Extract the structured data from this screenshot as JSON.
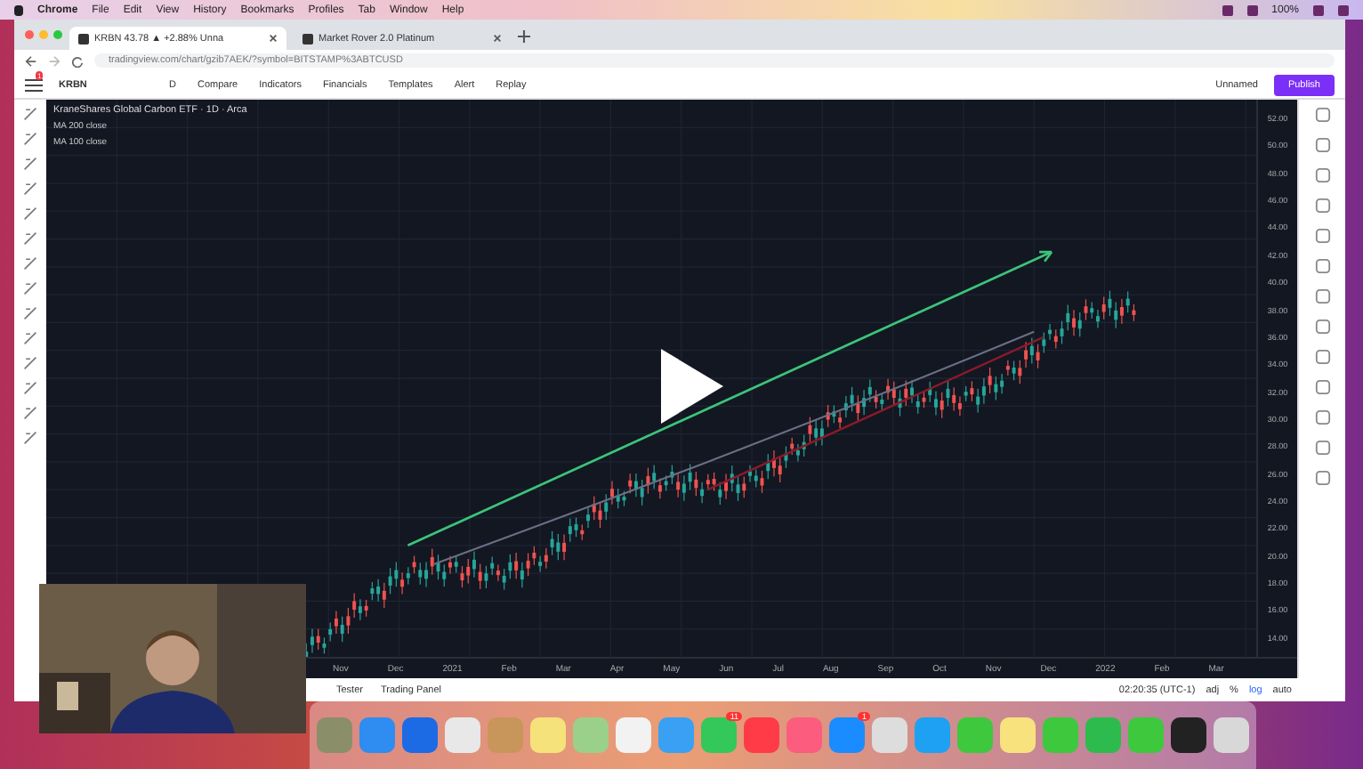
{
  "menu_bar": {
    "items": [
      "Chrome",
      "File",
      "Edit",
      "View",
      "History",
      "Bookmarks",
      "Profiles",
      "Tab",
      "Window",
      "Help"
    ],
    "battery": "100%"
  },
  "browser": {
    "tabs": [
      {
        "title": "KRBN 43.78 ▲ +2.88% Unna",
        "selected": true
      },
      {
        "title": "Market Rover 2.0 Platinum",
        "selected": false
      }
    ],
    "url": "tradingview.com/chart/gzib7AEK/?symbol=BITSTAMP%3ABTCUSD"
  },
  "toolbar": {
    "symbol": "KRBN",
    "interval": "D",
    "buttons": [
      "Compare",
      "Indicators",
      "Financials",
      "Templates",
      "Alert",
      "Replay"
    ],
    "layout_name": "Unnamed",
    "publish": "Publish",
    "alerts_badge": "1"
  },
  "chart": {
    "legend_title": "KraneShares Global Carbon ETF · 1D · Arca",
    "indicators": [
      "MA 200 close",
      "MA 100 close"
    ],
    "price_axis": [
      "52.00",
      "50.00",
      "48.00",
      "46.00",
      "44.00",
      "42.00",
      "40.00",
      "38.00",
      "36.00",
      "34.00",
      "32.00",
      "30.00",
      "28.00",
      "26.00",
      "24.00",
      "22.00",
      "20.00",
      "18.00",
      "16.00",
      "14.00"
    ],
    "time_axis": [
      "Nov",
      "Dec",
      "2021",
      "Feb",
      "Mar",
      "Apr",
      "May",
      "Jun",
      "Jul",
      "Aug",
      "Sep",
      "Oct",
      "Nov",
      "Dec",
      "2022",
      "Feb",
      "Mar"
    ]
  },
  "status": {
    "time": "02:20:35 (UTC-1)",
    "toggles": [
      {
        "label": "adj",
        "selected": false
      },
      {
        "label": "%",
        "selected": false
      },
      {
        "label": "log",
        "selected": true
      },
      {
        "label": "auto",
        "selected": false
      }
    ]
  },
  "bottom_tabs": [
    "Tester",
    "Trading Panel"
  ],
  "dock": [
    {
      "color": "#8a8f6a"
    },
    {
      "color": "#2f8cf0"
    },
    {
      "color": "#1d6ae5"
    },
    {
      "color": "#e8e8e8"
    },
    {
      "color": "#c8955a"
    },
    {
      "color": "#f5e27a"
    },
    {
      "color": "#9bd08a"
    },
    {
      "color": "#f2f2f2"
    },
    {
      "color": "#3aa0f3"
    },
    {
      "color": "#34c759",
      "badge": "11"
    },
    {
      "color": "#ff3b47"
    },
    {
      "color": "#fc5c7d"
    },
    {
      "color": "#1a8cff",
      "badge": "1"
    },
    {
      "color": "#dddddd"
    },
    {
      "color": "#1ea1f2"
    },
    {
      "color": "#3ec83e"
    },
    {
      "color": "#f7e27e"
    },
    {
      "color": "#3ec83e"
    },
    {
      "color": "#2dbb4e"
    },
    {
      "color": "#3ec83e"
    },
    {
      "color": "#222222"
    },
    {
      "color": "#d8d8d8"
    }
  ]
}
